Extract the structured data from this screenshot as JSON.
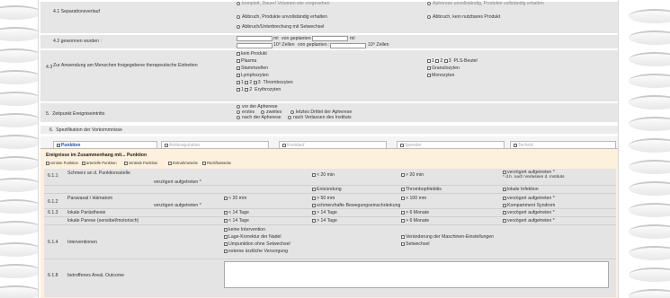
{
  "sections": {
    "s41": {
      "num": "4.1",
      "label": "Separationsverlauf",
      "opt_top_a": "komplett, Dauer/ Volumen wie vorgesehen",
      "opt_top_b": "Apherese unvollständig, Produkte vollständig erhalten",
      "opt_a": "Abbruch, Produkte unvollständig erhalten",
      "opt_b": "Abbruch, kein nutzbares Produkt",
      "opt_c": "Abbruch/Unterbrechung mit Setwechsel"
    },
    "s42": {
      "num": "4.2",
      "label": "gewonnen wurden :",
      "ml": "ml",
      "von_geplanten": "von geplanten :",
      "ml2": "ml",
      "zellen": "10⁹ Zellen",
      "von_geplanten2": "von geplanten :",
      "zellen2": "10⁹ Zellen"
    },
    "s43": {
      "num": "4.3",
      "label": "Zur Anwendung am Menschen freigegebene therapeutische Einheiten",
      "kein_produkt": "kein Produkt",
      "plasma": "Plasma",
      "stammzellen": "Stammzellen",
      "lymphozyten": "Lymphozyten",
      "thrombo": "Thrombozyten",
      "erythro": "Erythrozyten",
      "pls": "PLS-Beutel",
      "granulo": "Granulozyten",
      "mono": "Monozyten",
      "n1": "1",
      "n2": "2",
      "n3": "3"
    },
    "s5": {
      "num": "5.",
      "label": "Zeitpunkt Ereigniseintritts",
      "vor": "vor der Apherese",
      "erstes": "erstes",
      "zweites": "zweites",
      "letztes": "letztes Drittel der Apherese",
      "nach": "nach der Apherese",
      "nach_verlassen": "nach Verlassen des Instituts"
    },
    "s6": {
      "num": "6.",
      "label": "Spezifikation der Vorkommnisse"
    }
  },
  "tabs": [
    "Punktion",
    "Antikoagulation",
    "Kreislauf",
    "Spender",
    "Technik"
  ],
  "panel": {
    "title": "Ereignisse im Zusammenhang mit... Punktion",
    "filters": [
      "venöse Punktion",
      "arterielle Punktion",
      "zentrale Punktion",
      "Entnahmeseite",
      "Rückflussseite"
    ],
    "rows": {
      "r611a": {
        "num": "6.1.1",
        "label": "Schmerz an d. Punktionsstelle"
      },
      "r611b": {
        "label": "verzögert aufgetreten *"
      },
      "r612a": {
        "num": "6.1.2",
        "label": "Paravasat / Hämatom"
      },
      "r612b": {
        "label": "verzögert aufgetreten *"
      },
      "r613": {
        "num": "6.1.3",
        "label": "lokale Parästhesie"
      },
      "r613b": {
        "label": "lokale Parese (sensibel/motorisch)"
      },
      "r614": {
        "num": "6.1.4",
        "label": "Interventionen"
      },
      "r618": {
        "num": "6.1.8",
        "label": "betroffenes Areal, Outcome"
      }
    },
    "opts": {
      "lt20": "< 20 min",
      "gt20": "> 20 min",
      "verz1": "verzögert aufgetreten *",
      "dh": "* d.h. nach Verlassen d. Instituts",
      "entz": "Entzündung",
      "thromb": "Thrombophlebitis",
      "lokInf": "lokale Infektion",
      "lt20mm": "< 20 mm",
      "gt50": "> 50 mm",
      "gt100": "> 100 mm",
      "verz2": "verzögert aufgetreten *",
      "schmerz": "schmerzhafte Bewegungseinschränkung",
      "komp": "Kompartment Syndrom",
      "lt14a": "< 14 Tage",
      "gt14a": "> 14 Tage",
      "gt6a": "> 6 Monate",
      "verz3": "verzögert aufgetreten *",
      "lt14b": "< 14 Tage",
      "gt14b": "> 14 Tage",
      "gt6b": "> 6 Monate",
      "verz4": "verzögert aufgetreten *",
      "keine": "keine Intervention",
      "lage": "Lage-Korrektur der Nadel",
      "veraend": "Veränderung der Maschinen-Einstellungen",
      "umpunk": "Umpunktion ohne Setwechsel",
      "setw": "Setwechsel",
      "extern": "externe ärztliche Versorgung"
    }
  }
}
